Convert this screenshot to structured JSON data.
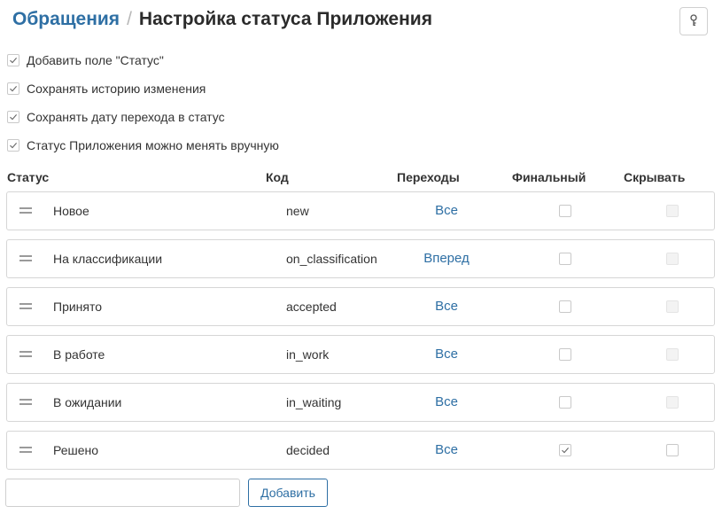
{
  "breadcrumb": {
    "link": "Обращения",
    "separator": "/",
    "title": "Настройка статуса Приложения"
  },
  "help": {
    "icon": "key-icon"
  },
  "options": [
    {
      "label": "Добавить поле \"Статус\"",
      "checked": true
    },
    {
      "label": "Сохранять историю изменения",
      "checked": true
    },
    {
      "label": "Сохранять дату перехода в статус",
      "checked": true
    },
    {
      "label": "Статус Приложения можно менять вручную",
      "checked": true
    }
  ],
  "table": {
    "headers": {
      "status": "Статус",
      "code": "Код",
      "transitions": "Переходы",
      "final": "Финальный",
      "hide": "Скрывать"
    },
    "rows": [
      {
        "name": "Новое",
        "code": "new",
        "transitions": "Все",
        "final": false,
        "hide": false,
        "hide_disabled": true
      },
      {
        "name": "На классификации",
        "code": "on_classification",
        "transitions": "Вперед",
        "final": false,
        "hide": false,
        "hide_disabled": true
      },
      {
        "name": "Принято",
        "code": "accepted",
        "transitions": "Все",
        "final": false,
        "hide": false,
        "hide_disabled": true
      },
      {
        "name": "В работе",
        "code": "in_work",
        "transitions": "Все",
        "final": false,
        "hide": false,
        "hide_disabled": true
      },
      {
        "name": "В ожидании",
        "code": "in_waiting",
        "transitions": "Все",
        "final": false,
        "hide": false,
        "hide_disabled": true
      },
      {
        "name": "Решено",
        "code": "decided",
        "transitions": "Все",
        "final": true,
        "hide": false,
        "hide_disabled": false
      }
    ]
  },
  "footer": {
    "input_value": "",
    "add_label": "Добавить"
  },
  "colors": {
    "accent": "#2e6fa4",
    "border": "#d6d6d6"
  }
}
